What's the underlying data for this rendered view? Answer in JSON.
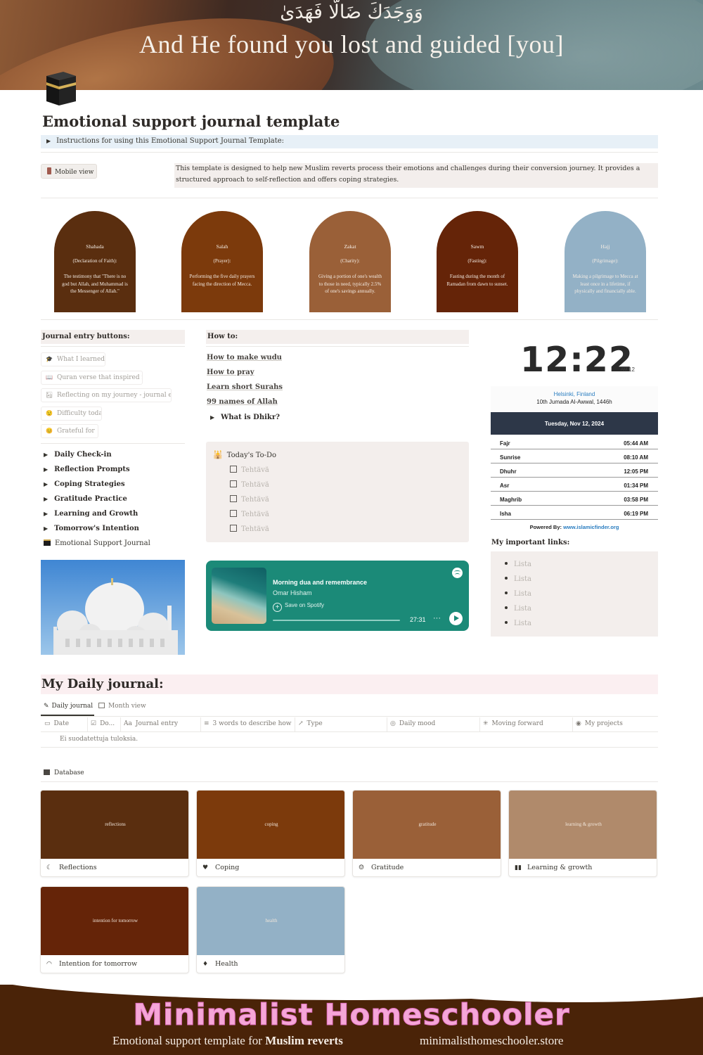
{
  "banner": {
    "arabic": "وَوَجَدَكَ ضَالًّا فَهَدَىٰ",
    "tagline": "And He found you lost and guided [you]"
  },
  "page": {
    "title": "Emotional support journal template",
    "instructions_toggle": "Instructions for using this Emotional Support Journal Template:",
    "mobile_view_label": "Mobile view",
    "callout": "This template is designed to help new Muslim reverts process their emotions and challenges during their conversion journey. It provides a structured approach to self-reflection and offers coping strategies."
  },
  "pillars": [
    {
      "title": "Shahada",
      "subtitle": "(Declaration of Faith):",
      "desc": "The testimony that \"There is no god but Allah, and Muhammad is the Messenger of Allah.\"",
      "color": "#5a2e0f"
    },
    {
      "title": "Salah",
      "subtitle": "(Prayer):",
      "desc": "Performing the five daily prayers facing the direction of Mecca.",
      "color": "#7c3a0c"
    },
    {
      "title": "Zakat",
      "subtitle": "(Charity):",
      "desc": "Giving a portion of one's wealth to those in need, typically 2.5% of one's savings annually.",
      "color": "#9a6038"
    },
    {
      "title": "Sawm",
      "subtitle": "(Fasting):",
      "desc": "Fasting during the month of Ramadan from dawn to sunset.",
      "color": "#652408"
    },
    {
      "title": "Hajj",
      "subtitle": "(Pilgrimage):",
      "desc": "Making a pilgrimage to Mecca at least once in a lifetime, if physically and financially able.",
      "color": "#93b1c6"
    }
  ],
  "journal_buttons": {
    "heading": "Journal entry buttons:",
    "items": [
      {
        "label": "What I learned today",
        "icon": "graduation-cap-icon"
      },
      {
        "label": "Quran verse that inspired me",
        "icon": "book-icon"
      },
      {
        "label": "Reflecting on my journey - journal en...",
        "icon": "path-icon"
      },
      {
        "label": "Difficulty today",
        "icon": "sad-face-icon"
      },
      {
        "label": "Grateful for",
        "icon": "smile-face-icon"
      }
    ]
  },
  "toggles": [
    "Daily Check-in",
    "Reflection Prompts",
    "Coping Strategies",
    "Gratitude Practice",
    "Learning and Growth",
    "Tomorrow's Intention"
  ],
  "journal_page_link": "Emotional Support Journal",
  "how_to": {
    "heading": "How to:",
    "links": [
      "How to make wudu",
      "How to pray",
      "Learn short Surahs",
      "99 names of Allah"
    ],
    "toggle": "What is Dhikr?"
  },
  "todo": {
    "title": "Today's To-Do",
    "items": [
      "Tehtävä",
      "Tehtävä",
      "Tehtävä",
      "Tehtävä",
      "Tehtävä"
    ]
  },
  "spotify": {
    "title": "Morning dua and remembrance",
    "artist": "Omar Hisham",
    "save_label": "Save on Spotify",
    "duration": "27:31",
    "more": "···"
  },
  "clock": {
    "time": "12:22",
    "ampm": "AM",
    "seconds": "12"
  },
  "prayer_times": {
    "city": "Helsinki, Finland",
    "hijri_date": "10th Jumada Al-Awwal, 1446h",
    "date": "Tuesday, Nov 12, 2024",
    "times": [
      {
        "name": "Fajr",
        "time": "05:44 AM"
      },
      {
        "name": "Sunrise",
        "time": "08:10 AM"
      },
      {
        "name": "Dhuhr",
        "time": "12:05 PM"
      },
      {
        "name": "Asr",
        "time": "01:34 PM"
      },
      {
        "name": "Maghrib",
        "time": "03:58 PM"
      },
      {
        "name": "Isha",
        "time": "06:19 PM"
      }
    ],
    "powered_by": "Powered By:",
    "powered_link": "www.islamicfinder.org"
  },
  "important_links": {
    "heading": "My important links:",
    "items": [
      "Lista",
      "Lista",
      "Lista",
      "Lista",
      "Lista"
    ]
  },
  "daily_journal": {
    "heading": "My Daily journal:",
    "views": [
      "Daily journal",
      "Month view"
    ],
    "columns": [
      "Date",
      "Do...",
      "Journal entry",
      "3 words to describe how ...",
      "Type",
      "Daily mood",
      "Moving forward",
      "My projects"
    ],
    "empty_message": "Ei suodatettuja tuloksia."
  },
  "database": {
    "label": "Database",
    "cards": [
      {
        "cover_text": "reflections",
        "caption": "Reflections",
        "icon": "moon-icon",
        "color": "#5a2e0f"
      },
      {
        "cover_text": "coping",
        "caption": "Coping",
        "icon": "heart-icon",
        "color": "#7c3a0c"
      },
      {
        "cover_text": "gratitude",
        "caption": "Gratitude",
        "icon": "smile-icon",
        "color": "#9a6038"
      },
      {
        "cover_text": "learning & growth",
        "caption": "Learning & growth",
        "icon": "book-open-icon",
        "color": "#b08a6b"
      },
      {
        "cover_text": "intention for tomorrow",
        "caption": "Intention for tomorrow",
        "icon": "rainbow-icon",
        "color": "#652408"
      },
      {
        "cover_text": "health",
        "caption": "Health",
        "icon": "leaf-icon",
        "color": "#93b1c6"
      }
    ]
  },
  "footer": {
    "brand": "Minimalist Homeschooler",
    "subtitle_prefix": "Emotional support template for ",
    "subtitle_bold": "Muslim reverts",
    "website": "minimalisthomeschooler.store"
  }
}
